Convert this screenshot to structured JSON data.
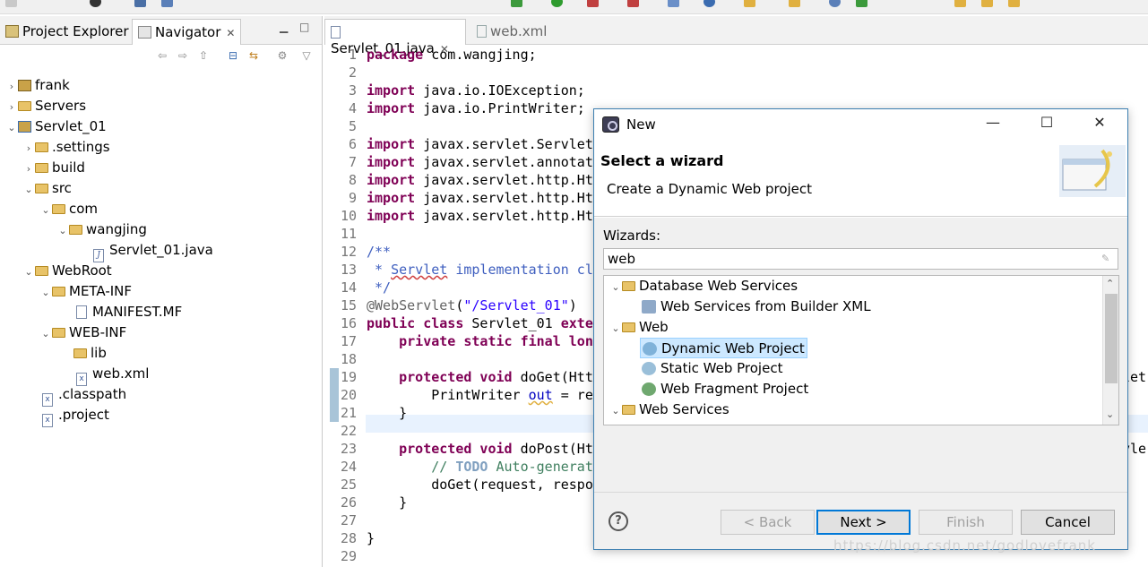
{
  "left_panel": {
    "tabs": [
      {
        "label": "Project Explorer"
      },
      {
        "label": "Navigator"
      }
    ],
    "tree": [
      {
        "label": "frank",
        "icon": "project-icon",
        "expanded": false
      },
      {
        "label": "Servers",
        "icon": "folder-icon",
        "expanded": false
      },
      {
        "label": "Servlet_01",
        "icon": "project-icon",
        "expanded": true
      },
      {
        "label": ".settings",
        "icon": "folder-icon",
        "expanded": false
      },
      {
        "label": "build",
        "icon": "folder-icon",
        "expanded": false
      },
      {
        "label": "src",
        "icon": "folder-icon",
        "expanded": true
      },
      {
        "label": "com",
        "icon": "folder-icon",
        "expanded": true
      },
      {
        "label": "wangjing",
        "icon": "folder-icon",
        "expanded": true
      },
      {
        "label": "Servlet_01.java",
        "icon": "java-file-icon"
      },
      {
        "label": "WebRoot",
        "icon": "folder-icon",
        "expanded": true
      },
      {
        "label": "META-INF",
        "icon": "folder-icon",
        "expanded": true
      },
      {
        "label": "MANIFEST.MF",
        "icon": "file-icon"
      },
      {
        "label": "WEB-INF",
        "icon": "folder-icon",
        "expanded": true
      },
      {
        "label": "lib",
        "icon": "folder-icon"
      },
      {
        "label": "web.xml",
        "icon": "xml-file-icon"
      },
      {
        "label": ".classpath",
        "icon": "xml-file-icon"
      },
      {
        "label": ".project",
        "icon": "xml-file-icon"
      }
    ]
  },
  "editor": {
    "tabs": [
      {
        "label": "Servlet_01.java"
      },
      {
        "label": "web.xml"
      }
    ],
    "line_numbers": [
      "1",
      "2",
      "3",
      "4",
      "5",
      "6",
      "7",
      "8",
      "9",
      "10",
      "11",
      "12",
      "13",
      "14",
      "15",
      "16",
      "17",
      "18",
      "19",
      "20",
      "21",
      "22",
      "23",
      "24",
      "25",
      "26",
      "27",
      "28",
      "29"
    ],
    "lines": {
      "l1a": "package",
      "l1b": " com.wangjing;",
      "l3a": "import",
      "l3b": " java.io.IOException;",
      "l4a": "import",
      "l4b": " java.io.PrintWriter;",
      "l6a": "import",
      "l6b": " javax.servlet.Servlet",
      "l7a": "import",
      "l7b": " javax.servlet.annotat",
      "l8a": "import",
      "l8b": " javax.servlet.http.Ht",
      "l9a": "import",
      "l9b": " javax.servlet.http.Ht",
      "l10a": "import",
      "l10b": " javax.servlet.http.Ht",
      "l12": "/**",
      "l13a": " * ",
      "l13b": "Servlet",
      "l13c": " implementation cl",
      "l14": " */",
      "l15a": "@WebServlet",
      "l15b": "(",
      "l15c": "\"/Servlet_01\"",
      "l15d": ")",
      "l16a": "public class",
      "l16b": " Servlet_01 ",
      "l16c": "exte",
      "l17a": "    private static final",
      "l17b": " ",
      "l17c": "lon",
      "l19a": "    protected void",
      "l19b": " doGet(Htt",
      "l19r": "let",
      "l20a": "        PrintWriter ",
      "l20b": "out",
      "l20c": " = re",
      "l21": "    }",
      "l23a": "    protected void",
      "l23b": " doPost(Ht",
      "l23r": "vle",
      "l24a": "        // ",
      "l24b": "TODO",
      "l24c": " Auto-generat",
      "l25": "        doGet(request, respo",
      "l26": "    }",
      "l28": "}"
    }
  },
  "dialog": {
    "title": "New",
    "heading": "Select a wizard",
    "description": "Create a Dynamic Web project",
    "wizards_label": "Wizards:",
    "filter_value": "web",
    "tree": [
      {
        "label": "Database Web Services",
        "type": "category"
      },
      {
        "label": "Web Services from Builder XML",
        "type": "item"
      },
      {
        "label": "Web",
        "type": "category"
      },
      {
        "label": "Dynamic Web Project",
        "type": "item",
        "selected": true
      },
      {
        "label": "Static Web Project",
        "type": "item"
      },
      {
        "label": "Web Fragment Project",
        "type": "item"
      },
      {
        "label": "Web Services",
        "type": "category"
      }
    ],
    "buttons": {
      "back": "< Back",
      "next": "Next >",
      "finish": "Finish",
      "cancel": "Cancel",
      "help": "?"
    }
  },
  "watermark": "https://blog.csdn.net/godlovefrank",
  "colors": {
    "keyword": "#7f0055",
    "comment": "#3f5fbf",
    "string": "#2a00ff",
    "selection": "#cce8ff",
    "default_button_border": "#0078d7"
  }
}
